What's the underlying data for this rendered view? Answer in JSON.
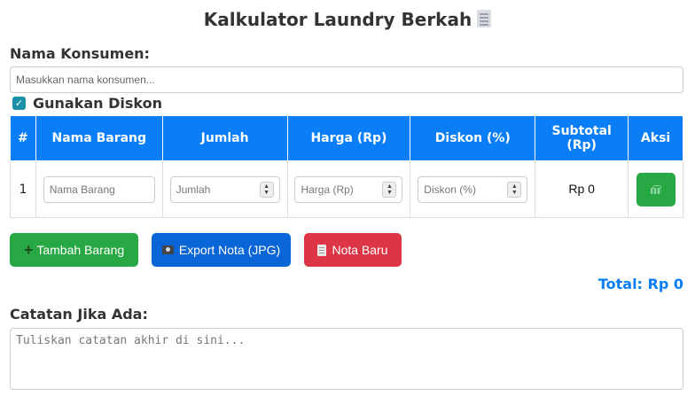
{
  "header": {
    "title": "Kalkulator Laundry Berkah",
    "title_icon": "receipt-icon"
  },
  "consumer": {
    "label": "Nama Konsumen:",
    "placeholder": "Masukkan nama konsumen...",
    "value": ""
  },
  "discount": {
    "label": "Gunakan Diskon",
    "checked": true
  },
  "table": {
    "headers": [
      "#",
      "Nama Barang",
      "Jumlah",
      "Harga (Rp)",
      "Diskon (%)",
      "Subtotal (Rp)",
      "Aksi"
    ],
    "rows": [
      {
        "no": "1",
        "name_placeholder": "Nama Barang",
        "qty_placeholder": "Jumlah",
        "price_placeholder": "Harga (Rp)",
        "discount_placeholder": "Diskon (%)",
        "subtotal": "Rp 0",
        "action_icon": "basket-icon"
      }
    ]
  },
  "buttons": {
    "add": "Tambah Barang",
    "export": "Export Nota (JPG)",
    "new": "Nota Baru"
  },
  "total": "Total: Rp 0",
  "notes": {
    "label": "Catatan Jika Ada:",
    "placeholder": "Tuliskan catatan akhir di sini..."
  },
  "colors": {
    "primary": "#0a7ef7",
    "success": "#28a745",
    "danger": "#dc3545",
    "export": "#0a66d6"
  }
}
